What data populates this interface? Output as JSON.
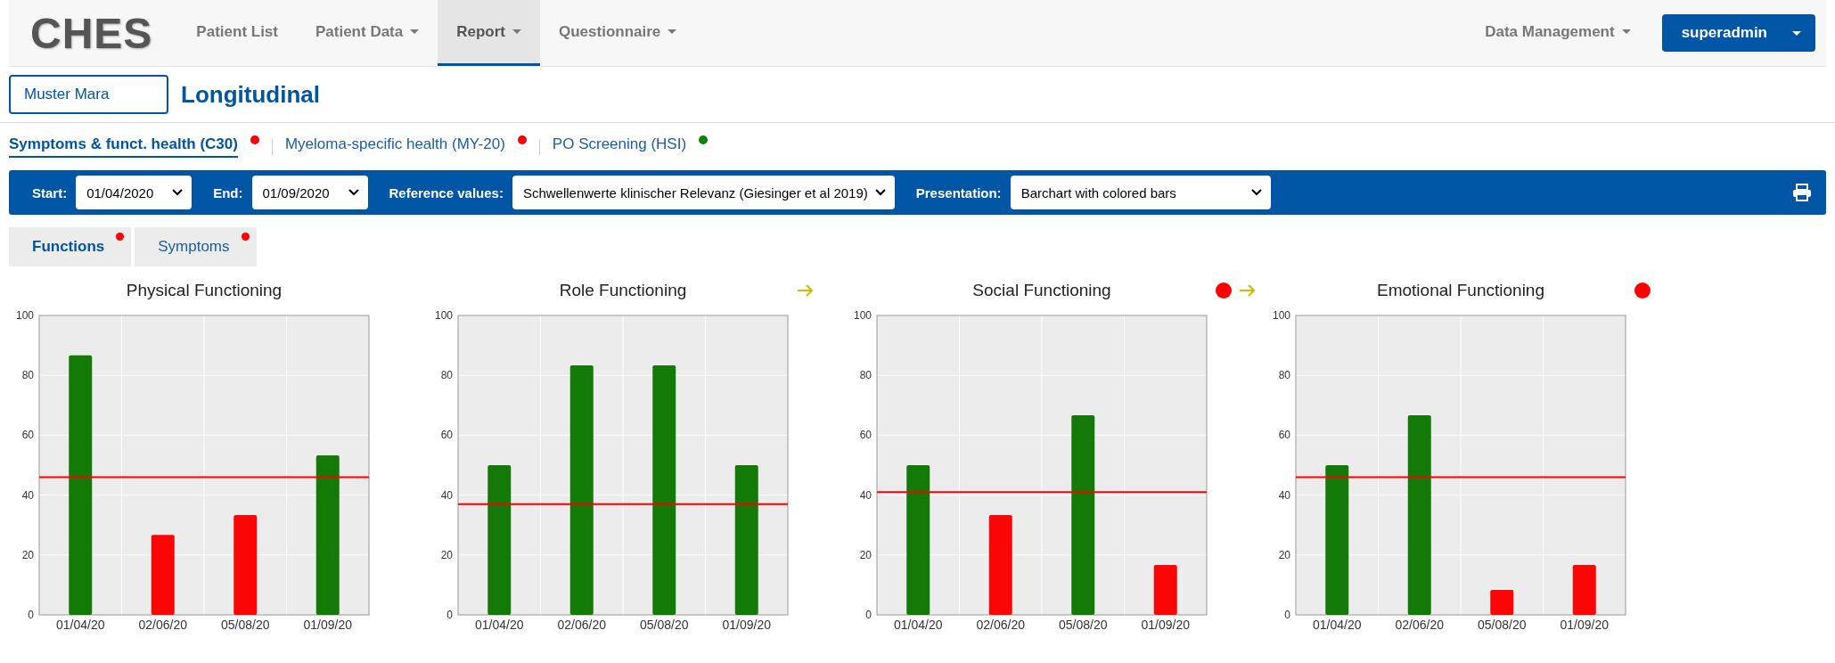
{
  "navbar": {
    "logo": "CHES",
    "items": [
      {
        "label": "Patient List",
        "dropdown": false,
        "selected": false
      },
      {
        "label": "Patient Data",
        "dropdown": true,
        "selected": false
      },
      {
        "label": "Report",
        "dropdown": true,
        "selected": true
      },
      {
        "label": "Questionnaire",
        "dropdown": true,
        "selected": false
      }
    ],
    "right_item": {
      "label": "Data Management",
      "dropdown": true
    },
    "user_button": {
      "label": "superadmin"
    }
  },
  "patient": {
    "value": "Muster Mara"
  },
  "page_title": "Longitudinal",
  "questionnaire_tabs": [
    {
      "label": "Symptoms & funct. health (C30)",
      "selected": true,
      "color": "#ff0000"
    },
    {
      "label": "Myeloma-specific health (MY-20)",
      "selected": false,
      "color": "#ff0000"
    },
    {
      "label": "PO Screening (HSI)",
      "selected": false,
      "color": "#108010"
    }
  ],
  "filters": [
    {
      "label": "Start:",
      "value": "01/04/2020",
      "kind": "short"
    },
    {
      "label": "End:",
      "value": "01/09/2020",
      "kind": "short"
    },
    {
      "label": "Reference values:",
      "value": "Schwellenwerte klinischer Relevanz (Giesinger et al 2019)",
      "kind": "wide"
    },
    {
      "label": "Presentation:",
      "value": "Barchart with colored bars",
      "kind": "wide"
    }
  ],
  "category_tabs": [
    {
      "label": "Functions",
      "selected": true,
      "alert": true
    },
    {
      "label": "Symptoms",
      "selected": false,
      "alert": true
    }
  ],
  "charts": [
    {
      "alert": false,
      "trend_arrow": false,
      "chart_data": {
        "type": "bar",
        "title": "Physical Functioning",
        "categories": [
          "01/04/20",
          "02/06/20",
          "05/08/20",
          "01/09/20"
        ],
        "values": [
          86.7,
          26.7,
          33.3,
          53.3
        ],
        "ylim": [
          0,
          100
        ],
        "yticks": [
          0,
          20,
          40,
          60,
          80,
          100
        ],
        "grid": true,
        "ref_lines": [
          {
            "axis": "y",
            "value": 46
          }
        ]
      }
    },
    {
      "alert": false,
      "trend_arrow": true,
      "chart_data": {
        "type": "bar",
        "title": "Role Functioning",
        "categories": [
          "01/04/20",
          "02/06/20",
          "05/08/20",
          "01/09/20"
        ],
        "values": [
          50,
          83.3,
          83.3,
          50
        ],
        "ylim": [
          0,
          100
        ],
        "yticks": [
          0,
          20,
          40,
          60,
          80,
          100
        ],
        "grid": true,
        "ref_lines": [
          {
            "axis": "y",
            "value": 37
          }
        ]
      }
    },
    {
      "alert": true,
      "trend_arrow": true,
      "chart_data": {
        "type": "bar",
        "title": "Social Functioning",
        "categories": [
          "01/04/20",
          "02/06/20",
          "05/08/20",
          "01/09/20"
        ],
        "values": [
          50,
          33.3,
          66.7,
          16.7
        ],
        "ylim": [
          0,
          100
        ],
        "yticks": [
          0,
          20,
          40,
          60,
          80,
          100
        ],
        "grid": true,
        "ref_lines": [
          {
            "axis": "y",
            "value": 41
          }
        ]
      }
    },
    {
      "alert": true,
      "trend_arrow": false,
      "chart_data": {
        "type": "bar",
        "title": "Emotional Functioning",
        "categories": [
          "01/04/20",
          "02/06/20",
          "05/08/20",
          "01/09/20"
        ],
        "values": [
          50,
          66.7,
          8.3,
          16.7
        ],
        "ylim": [
          0,
          100
        ],
        "yticks": [
          0,
          20,
          40,
          60,
          80,
          100
        ],
        "grid": true,
        "ref_lines": [
          {
            "axis": "y",
            "value": 46
          }
        ]
      }
    }
  ]
}
